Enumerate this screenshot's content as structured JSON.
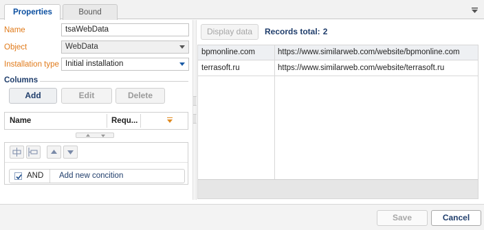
{
  "tabs": [
    {
      "label": "Properties",
      "active": true
    },
    {
      "label": "Bound Data",
      "active": false
    }
  ],
  "colors": {
    "label_orange": "#e07a1a",
    "title_blue": "#1f3d6b",
    "active_tab_blue": "#0b4fa0"
  },
  "properties": {
    "name": {
      "label": "Name",
      "value": "tsaWebData"
    },
    "object": {
      "label": "Object",
      "value": "WebData"
    },
    "installation_type": {
      "label": "Installation type",
      "value": "Initial installation"
    }
  },
  "columns": {
    "title": "Columns",
    "buttons": {
      "add": "Add",
      "edit": "Edit",
      "delete": "Delete"
    },
    "headers": {
      "name": "Name",
      "required": "Requ..."
    }
  },
  "filter": {
    "toolbar_icons": [
      "add-condition-icon",
      "add-group-icon",
      "move-up-icon",
      "move-down-icon"
    ],
    "condition": {
      "checked": true,
      "operator": "AND",
      "new_condition": "Add new concition"
    }
  },
  "data_panel": {
    "display_button": "Display data",
    "records_label": "Records total:",
    "records_count": "2",
    "rows": [
      {
        "domain": "bpmonline.com",
        "url": "https://www.similarweb.com/website/bpmonline.com"
      },
      {
        "domain": "terrasoft.ru",
        "url": "https://www.similarweb.com/website/terrasoft.ru"
      }
    ]
  },
  "footer": {
    "save": "Save",
    "cancel": "Cancel"
  }
}
